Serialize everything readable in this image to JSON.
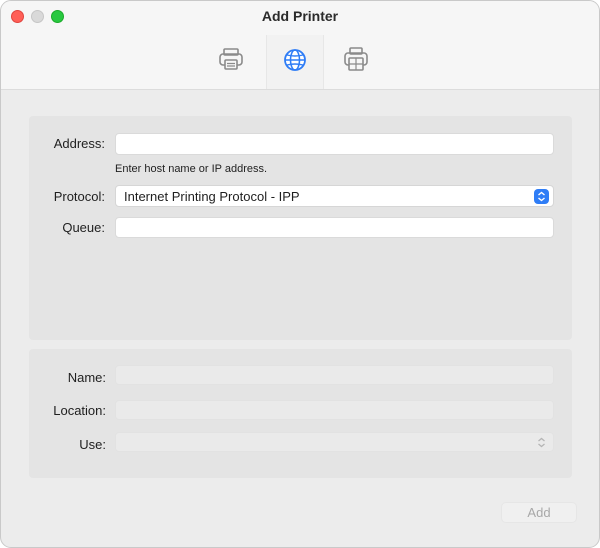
{
  "window": {
    "title": "Add Printer"
  },
  "toolbar": {
    "items": [
      {
        "icon": "printer-icon",
        "selected": false
      },
      {
        "icon": "globe-icon",
        "selected": true
      },
      {
        "icon": "printer-windows-icon",
        "selected": false
      }
    ]
  },
  "form": {
    "address": {
      "label": "Address:",
      "value": "",
      "hint": "Enter host name or IP address."
    },
    "protocol": {
      "label": "Protocol:",
      "value": "Internet Printing Protocol - IPP"
    },
    "queue": {
      "label": "Queue:",
      "value": ""
    },
    "name": {
      "label": "Name:",
      "value": ""
    },
    "location": {
      "label": "Location:",
      "value": ""
    },
    "use": {
      "label": "Use:",
      "value": ""
    }
  },
  "footer": {
    "add_label": "Add"
  },
  "colors": {
    "accent": "#2f7df6",
    "close": "#ff5f57",
    "zoom": "#28c840"
  }
}
